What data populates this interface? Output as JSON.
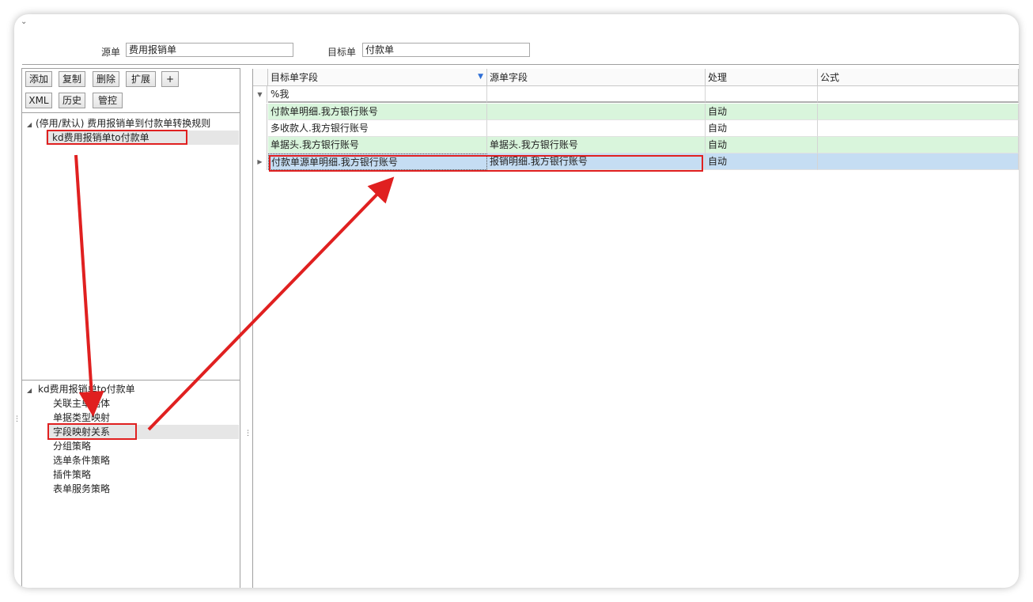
{
  "header": {
    "source_label": "源单",
    "source_value": "费用报销单",
    "target_label": "目标单",
    "target_value": "付款单"
  },
  "toolbar": {
    "add": "添加",
    "copy": "复制",
    "delete": "删除",
    "extend": "扩展",
    "plus": "+",
    "xml": "XML",
    "history": "历史",
    "control": "管控"
  },
  "rules_tree": {
    "root": "(停用/默认) 费用报销单到付款单转换规则",
    "child": "kd费用报销单to付款单"
  },
  "strategy_tree": {
    "root": "kd费用报销单to付款单",
    "items": [
      "关联主单据体",
      "单据类型映射",
      "字段映射关系",
      "分组策略",
      "选单条件策略",
      "插件策略",
      "表单服务策略"
    ]
  },
  "grid": {
    "columns": [
      "目标单字段",
      "源单字段",
      "处理",
      "公式"
    ],
    "filter_text": "%我",
    "rows": [
      {
        "target": "付款单明细.我方银行账号",
        "source": "",
        "process": "自动",
        "formula": ""
      },
      {
        "target": "多收款人.我方银行账号",
        "source": "",
        "process": "自动",
        "formula": ""
      },
      {
        "target": "单据头.我方银行账号",
        "source": "单据头.我方银行账号",
        "process": "自动",
        "formula": ""
      },
      {
        "target": "付款单源单明细.我方银行账号",
        "source": "报销明细.我方银行账号",
        "process": "自动",
        "formula": ""
      }
    ]
  },
  "colors": {
    "row_green": "#d9f5dc",
    "row_selected": "#c5ddf3",
    "annotation_red": "#e02020"
  },
  "icons": {
    "collapse": "chevron-down-icon",
    "filter": "funnel-icon",
    "current_row": "triangle-right-icon",
    "expand": "triangle-down-icon"
  }
}
